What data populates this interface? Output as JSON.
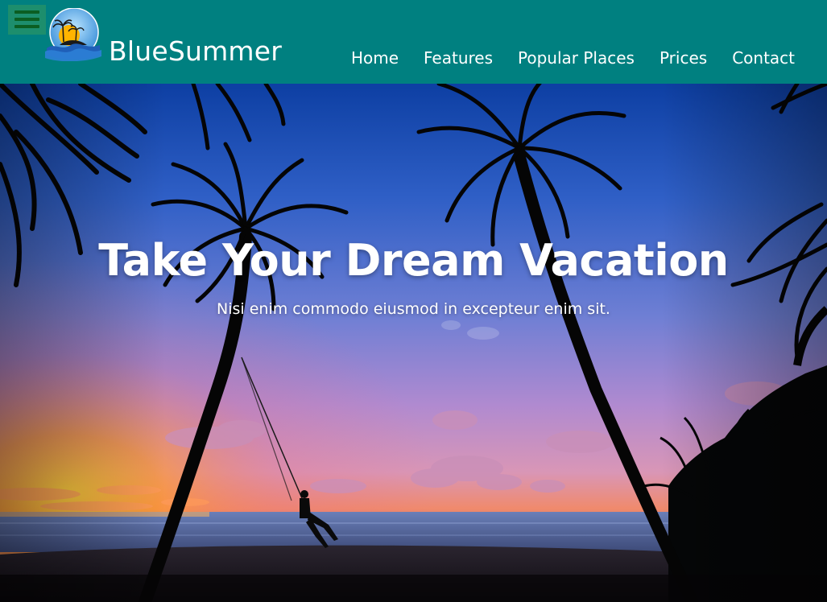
{
  "header": {
    "brand_name": "BlueSummer",
    "nav_items": [
      {
        "label": "Home"
      },
      {
        "label": "Features"
      },
      {
        "label": "Popular Places"
      },
      {
        "label": "Prices"
      },
      {
        "label": "Contact"
      }
    ],
    "menu_icon": "hamburger-menu-icon",
    "logo_icon": "palm-island-logo",
    "background_color": "#008080"
  },
  "hero": {
    "title": "Take Your Dream Vacation",
    "subtitle": "Nisi enim commodo eiusmod in excepteur enim sit.",
    "image": "sunset-beach-palm-trees-swing-photo"
  }
}
